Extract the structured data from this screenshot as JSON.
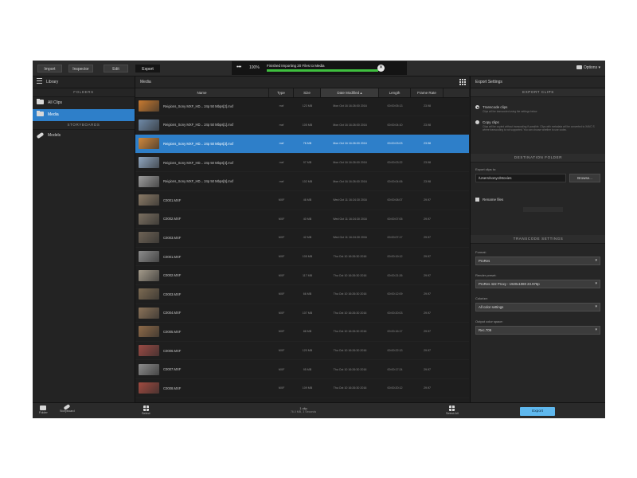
{
  "topbar": {
    "tabs": [
      {
        "label": "Import",
        "active": false
      },
      {
        "label": "Inspector",
        "active": false
      },
      {
        "label": "Edit",
        "active": false
      },
      {
        "label": "Export",
        "active": true
      }
    ],
    "progress": {
      "dots": "•••",
      "percent_label": "100%",
      "status": "Finished Importing 20 Files to Media",
      "fraction": 1.0
    },
    "options_label": "Options"
  },
  "sidebar": {
    "header": "Library",
    "folders_section": "FOLDERS",
    "folders": [
      {
        "label": "All Clips",
        "active": false
      },
      {
        "label": "Media",
        "active": true
      }
    ],
    "storyboards_section": "STORYBOARDS",
    "storyboards": [
      {
        "label": "Models"
      }
    ]
  },
  "media": {
    "header": "Media",
    "columns": [
      "Name",
      "Type",
      "Size",
      "Date Modified",
      "Length",
      "Frame Rate"
    ],
    "sort_column": "Date Modified",
    "sort_indicator": "▴",
    "rows": [
      {
        "name": "Reigions_Sony MXF_HD... 24p 50 Mbps[2].mxf",
        "type": "mxf",
        "size": "123 MB",
        "date": "Mon Oct 16 16:26:00 2016",
        "length": "00:00:05:13",
        "fps": "23.98",
        "selected": false,
        "thumb": "#c87a30"
      },
      {
        "name": "Reigions_Sony MXF_HD... 24p 50 Mbps[1].mxf",
        "type": "mxf",
        "size": "105 MB",
        "date": "Mon Oct 16 16:26:00 2016",
        "length": "00:00:04:10",
        "fps": "23.98",
        "selected": false,
        "thumb": "#6f8aa8"
      },
      {
        "name": "Reigions_Sony MXF_HD... 24p 50 Mbps[3].mxf",
        "type": "mxf",
        "size": "76 MB",
        "date": "Mon Oct 16 16:26:00 2016",
        "length": "00:00:03:03",
        "fps": "23.98",
        "selected": true,
        "thumb": "#d0883c"
      },
      {
        "name": "Reigions_Sony MXF_HD... 24p 50 Mbps[4].mxf",
        "type": "mxf",
        "size": "97 MB",
        "date": "Mon Oct 16 16:26:00 2016",
        "length": "00:00:03:22",
        "fps": "23.98",
        "selected": false,
        "thumb": "#8fa6c0"
      },
      {
        "name": "Reigions_Sony MXF_HD... 24p 50 Mbps[5].mxf",
        "type": "mxf",
        "size": "102 MB",
        "date": "Mon Oct 16 16:26:00 2016",
        "length": "00:00:04:06",
        "fps": "23.98",
        "selected": false,
        "thumb": "#9c9c9c"
      },
      {
        "name": "C0001.MXF",
        "type": "MXF",
        "size": "46 MB",
        "date": "Wed Oct 11 16:24:30 2016",
        "length": "00:00:08:07",
        "fps": "29.97",
        "selected": false,
        "thumb": "#8a7a66"
      },
      {
        "name": "C0002.MXF",
        "type": "MXF",
        "size": "40 MB",
        "date": "Wed Oct 11 16:24:30 2016",
        "length": "00:00:07:05",
        "fps": "29.97",
        "selected": false,
        "thumb": "#7a6f60"
      },
      {
        "name": "C0003.MXF",
        "type": "MXF",
        "size": "42 MB",
        "date": "Wed Oct 11 16:24:30 2016",
        "length": "00:00:07:17",
        "fps": "29.97",
        "selected": false,
        "thumb": "#6e6356"
      },
      {
        "name": "C0001.MXF",
        "type": "MXF",
        "size": "105 MB",
        "date": "Thu Oct 10 16:26:30 2016",
        "length": "00:00:19:12",
        "fps": "29.97",
        "selected": false,
        "thumb": "#8c8c8c"
      },
      {
        "name": "C0002.MXF",
        "type": "MXF",
        "size": "117 MB",
        "date": "Thu Oct 10 16:26:30 2016",
        "length": "00:00:21:26",
        "fps": "29.97",
        "selected": false,
        "thumb": "#a39a8a"
      },
      {
        "name": "C0003.MXF",
        "type": "MXF",
        "size": "66 MB",
        "date": "Thu Oct 10 16:26:30 2016",
        "length": "00:00:12:09",
        "fps": "29.97",
        "selected": false,
        "thumb": "#7c6a52"
      },
      {
        "name": "C0004.MXF",
        "type": "MXF",
        "size": "107 MB",
        "date": "Thu Oct 10 16:26:30 2016",
        "length": "00:00:20:03",
        "fps": "29.97",
        "selected": false,
        "thumb": "#8a7258"
      },
      {
        "name": "C0005.MXF",
        "type": "MXF",
        "size": "88 MB",
        "date": "Thu Oct 10 16:26:30 2016",
        "length": "00:00:16:17",
        "fps": "29.97",
        "selected": false,
        "thumb": "#8e6a48"
      },
      {
        "name": "C0006.MXF",
        "type": "MXF",
        "size": "120 MB",
        "date": "Thu Oct 10 16:26:30 2016",
        "length": "00:00:22:13",
        "fps": "29.97",
        "selected": false,
        "thumb": "#9a4a44"
      },
      {
        "name": "C0007.MXF",
        "type": "MXF",
        "size": "95 MB",
        "date": "Thu Oct 10 16:26:30 2016",
        "length": "00:00:17:24",
        "fps": "29.97",
        "selected": false,
        "thumb": "#8c8c8c"
      },
      {
        "name": "C0008.MXF",
        "type": "MXF",
        "size": "109 MB",
        "date": "Thu Oct 10 16:26:30 2016",
        "length": "00:00:20:12",
        "fps": "29.97",
        "selected": false,
        "thumb": "#a04a40"
      }
    ]
  },
  "export": {
    "header": "Export Settings",
    "export_clips_section": "EXPORT CLIPS",
    "options": [
      {
        "label": "Transcode clips",
        "desc": "Clips will be transcoded using the settings below",
        "checked": true
      },
      {
        "label": "Copy clips",
        "desc": "Clips will be copied without transcoding if possible. Clips with metadata will be converted to XAVC S where transcoding is not supported. You can choose whether to use codec.",
        "checked": false
      }
    ],
    "destination_section": "DESTINATION FOLDER",
    "export_label": "Export clips to:",
    "path": "/Users/sonyc/Movies",
    "browse_label": "Browse...",
    "rename_label": "Rename files",
    "transcode_section": "TRANSCODE SETTINGS",
    "format_label": "Format:",
    "format_value": "ProRes",
    "preset_label": "Render preset:",
    "preset_value": "ProRes 422 Proxy - 1920x1080 23.976p",
    "colorspace_label": "Colorize:",
    "colorspace_value": "All color settings",
    "output_label": "Output color space:",
    "output_value": "Rec.709"
  },
  "bottombar": {
    "folder_label": "Folder",
    "storyboard_label": "Storyboard",
    "select_label": "Select",
    "status_line1": "1 clip",
    "status_line2": "76.0 MB, 3 Seconds",
    "select_all_label": "Select All",
    "export_label": "Export"
  },
  "colors": {
    "selection": "#2e7fc9",
    "progress": "#3fbf3f",
    "export_button": "#5fb8ee"
  }
}
